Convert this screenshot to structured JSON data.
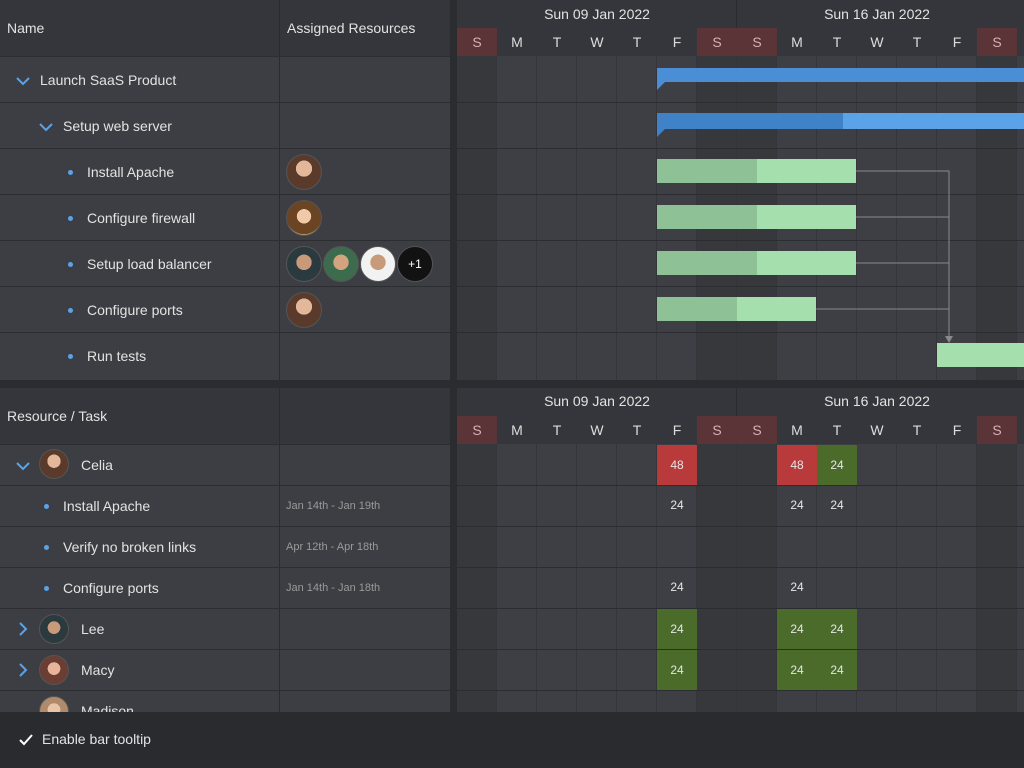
{
  "top_panel": {
    "col_name": "Name",
    "col_resources": "Assigned Resources",
    "week1": "Sun 09 Jan 2022",
    "week2": "Sun 16 Jan 2022",
    "days": [
      "S",
      "M",
      "T",
      "W",
      "T",
      "F",
      "S",
      "S",
      "M",
      "T",
      "W",
      "T",
      "F",
      "S"
    ],
    "rows": [
      {
        "label": "Launch SaaS Product"
      },
      {
        "label": "Setup web server"
      },
      {
        "label": "Install Apache"
      },
      {
        "label": "Configure firewall"
      },
      {
        "label": "Setup load balancer"
      },
      {
        "label": "Configure ports"
      },
      {
        "label": "Run tests"
      }
    ],
    "more_resources": "+1"
  },
  "bottom_panel": {
    "col_resource": "Resource / Task",
    "week1": "Sun 09 Jan 2022",
    "week2": "Sun 16 Jan 2022",
    "rows": [
      {
        "label": "Celia",
        "dates": ""
      },
      {
        "label": "Install Apache",
        "dates": "Jan 14th - Jan 19th"
      },
      {
        "label": "Verify no broken links",
        "dates": "Apr 12th - Apr 18th"
      },
      {
        "label": "Configure ports",
        "dates": "Jan 14th - Jan 18th"
      },
      {
        "label": "Lee",
        "dates": ""
      },
      {
        "label": "Macy",
        "dates": ""
      },
      {
        "label": "Madison",
        "dates": ""
      }
    ],
    "values": {
      "celia": [
        "48",
        "48",
        "24"
      ],
      "install": [
        "24",
        "24",
        "24"
      ],
      "ports": [
        "24",
        "24"
      ],
      "lee": [
        "24",
        "24",
        "24"
      ],
      "macy": [
        "24",
        "24",
        "24"
      ]
    }
  },
  "footer": {
    "tooltip_label": "Enable bar tooltip"
  },
  "colors": {
    "weekend": "#5a3437",
    "summary_bar": "#4a90d9",
    "task_done": "#8fc196",
    "task_todo": "#a6dfae",
    "overload": "#b83a3a",
    "ok": "#4a6b2a"
  }
}
